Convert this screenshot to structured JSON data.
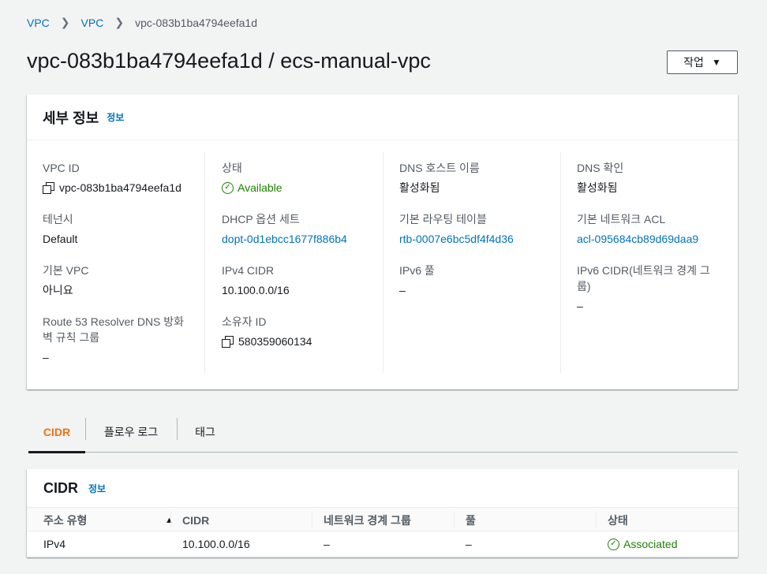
{
  "breadcrumb": {
    "items": [
      "VPC",
      "VPC"
    ],
    "current": "vpc-083b1ba4794eefa1d"
  },
  "page": {
    "title": "vpc-083b1ba4794eefa1d / ecs-manual-vpc",
    "actions_label": "작업"
  },
  "details": {
    "title": "세부 정보",
    "info": "정보",
    "fields": {
      "vpc_id": {
        "label": "VPC ID",
        "value": "vpc-083b1ba4794eefa1d"
      },
      "tenancy": {
        "label": "테넌시",
        "value": "Default"
      },
      "default_vpc": {
        "label": "기본 VPC",
        "value": "아니요"
      },
      "route53": {
        "label": "Route 53 Resolver DNS 방화벽 규칙 그룹",
        "value": "–"
      },
      "state": {
        "label": "상태",
        "value": "Available"
      },
      "dhcp": {
        "label": "DHCP 옵션 세트",
        "value": "dopt-0d1ebcc1677f886b4"
      },
      "ipv4_cidr": {
        "label": "IPv4 CIDR",
        "value": "10.100.0.0/16"
      },
      "owner": {
        "label": "소유자 ID",
        "value": "580359060134"
      },
      "dns_hostnames": {
        "label": "DNS 호스트 이름",
        "value": "활성화됨"
      },
      "route_table": {
        "label": "기본 라우팅 테이블",
        "value": "rtb-0007e6bc5df4f4d36"
      },
      "ipv6_pool": {
        "label": "IPv6 풀",
        "value": "–"
      },
      "dns_resolution": {
        "label": "DNS 확인",
        "value": "활성화됨"
      },
      "network_acl": {
        "label": "기본 네트워크 ACL",
        "value": "acl-095684cb89d69daa9"
      },
      "ipv6_cidr": {
        "label": "IPv6 CIDR(네트워크 경계 그룹)",
        "value": "–"
      }
    }
  },
  "tabs": [
    {
      "label": "CIDR",
      "active": true
    },
    {
      "label": "플로우 로그",
      "active": false
    },
    {
      "label": "태그",
      "active": false
    }
  ],
  "cidr": {
    "title": "CIDR",
    "info": "정보",
    "columns": [
      "주소 유형",
      "CIDR",
      "네트워크 경계 그룹",
      "풀",
      "상태"
    ],
    "rows": [
      [
        "IPv4",
        "10.100.0.0/16",
        "–",
        "–",
        "Associated"
      ]
    ]
  },
  "colors": {
    "link": "#0073bb",
    "success": "#1d8102",
    "active_tab": "#ec7211"
  }
}
